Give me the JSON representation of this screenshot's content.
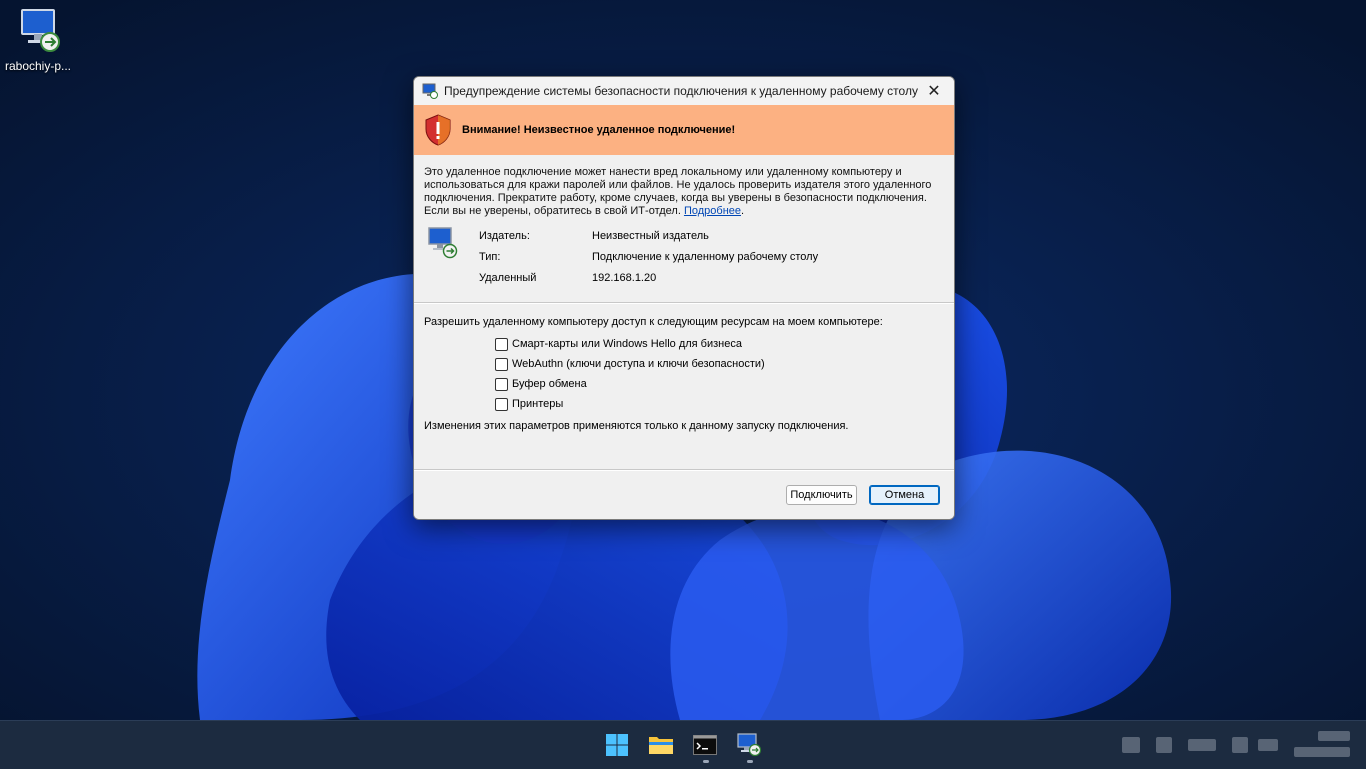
{
  "desktop": {
    "icon_label": "rabochiy-p..."
  },
  "dialog": {
    "title": "Предупреждение системы безопасности подключения к удаленному рабочему столу",
    "warning": "Внимание! Неизвестное удаленное подключение!",
    "description": "Это удаленное подключение может нанести вред локальному или удаленному компьютеру и использоваться для кражи паролей или файлов. Не удалось проверить издателя этого удаленного подключения. Прекратите работу, кроме случаев, когда вы уверены в безопасности подключения. Если вы не уверены, обратитесь в свой ИТ-отдел.",
    "more_link": "Подробнее",
    "publisher_label": "Издатель:",
    "publisher_value": "Неизвестный издатель",
    "type_label": "Тип:",
    "type_value": "Подключение к удаленному рабочему столу",
    "remote_label": "Удаленный компьютер:",
    "remote_value": "192.168.1.20",
    "permissions_title": "Разрешить удаленному компьютеру доступ к следующим ресурсам на моем компьютере:",
    "checkboxes": [
      {
        "label": "Смарт-карты или Windows Hello для бизнеса",
        "checked": false
      },
      {
        "label": "WebAuthn (ключи доступа и ключи безопасности)",
        "checked": false
      },
      {
        "label": "Буфер обмена",
        "checked": false
      },
      {
        "label": "Принтеры",
        "checked": false
      }
    ],
    "note": "Изменения этих параметров применяются только к данному запуску подключения.",
    "connect_button": "Подключить",
    "cancel_button": "Отмена"
  },
  "taskbar": {
    "items": [
      "start-icon",
      "file-explorer-icon",
      "terminal-icon",
      "remote-desktop-icon"
    ]
  },
  "colors": {
    "warning_banner": "#fcb182",
    "dialog_bg": "#f0f0f0",
    "taskbar_bg": "#1c2b40",
    "accent": "#0067c0"
  }
}
